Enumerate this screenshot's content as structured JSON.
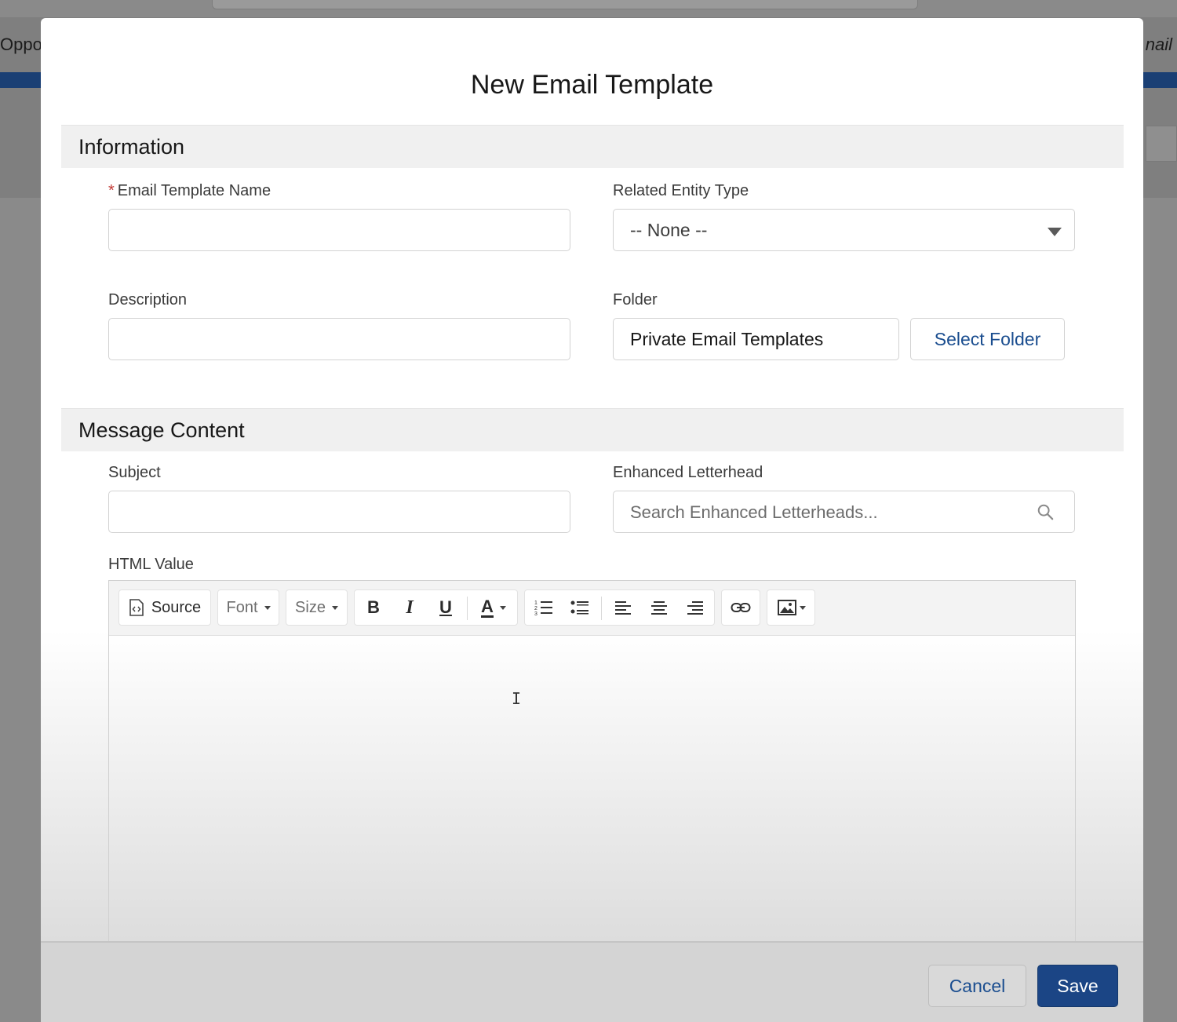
{
  "background": {
    "left_text": "Oppo",
    "right_text": "nail"
  },
  "modal": {
    "title": "New Email Template"
  },
  "information": {
    "section_title": "Information",
    "template_name": {
      "label": "Email Template Name",
      "required_marker": "*",
      "value": ""
    },
    "related_entity_type": {
      "label": "Related Entity Type",
      "value": "-- None --"
    },
    "description": {
      "label": "Description",
      "value": ""
    },
    "folder": {
      "label": "Folder",
      "value": "Private Email Templates",
      "select_button": "Select Folder"
    }
  },
  "message_content": {
    "section_title": "Message Content",
    "subject": {
      "label": "Subject",
      "value": ""
    },
    "enhanced_letterhead": {
      "label": "Enhanced Letterhead",
      "placeholder": "Search Enhanced Letterheads..."
    },
    "html_value": {
      "label": "HTML Value",
      "toolbar": {
        "source": "Source",
        "font": "Font",
        "size": "Size",
        "bold": "B",
        "italic": "I",
        "underline": "U",
        "text_color": "A"
      },
      "content": ""
    }
  },
  "footer": {
    "cancel": "Cancel",
    "save": "Save"
  },
  "colors": {
    "brand_blue": "#1b4585",
    "link_blue": "#1a4d8f",
    "required_red": "#c23934"
  }
}
